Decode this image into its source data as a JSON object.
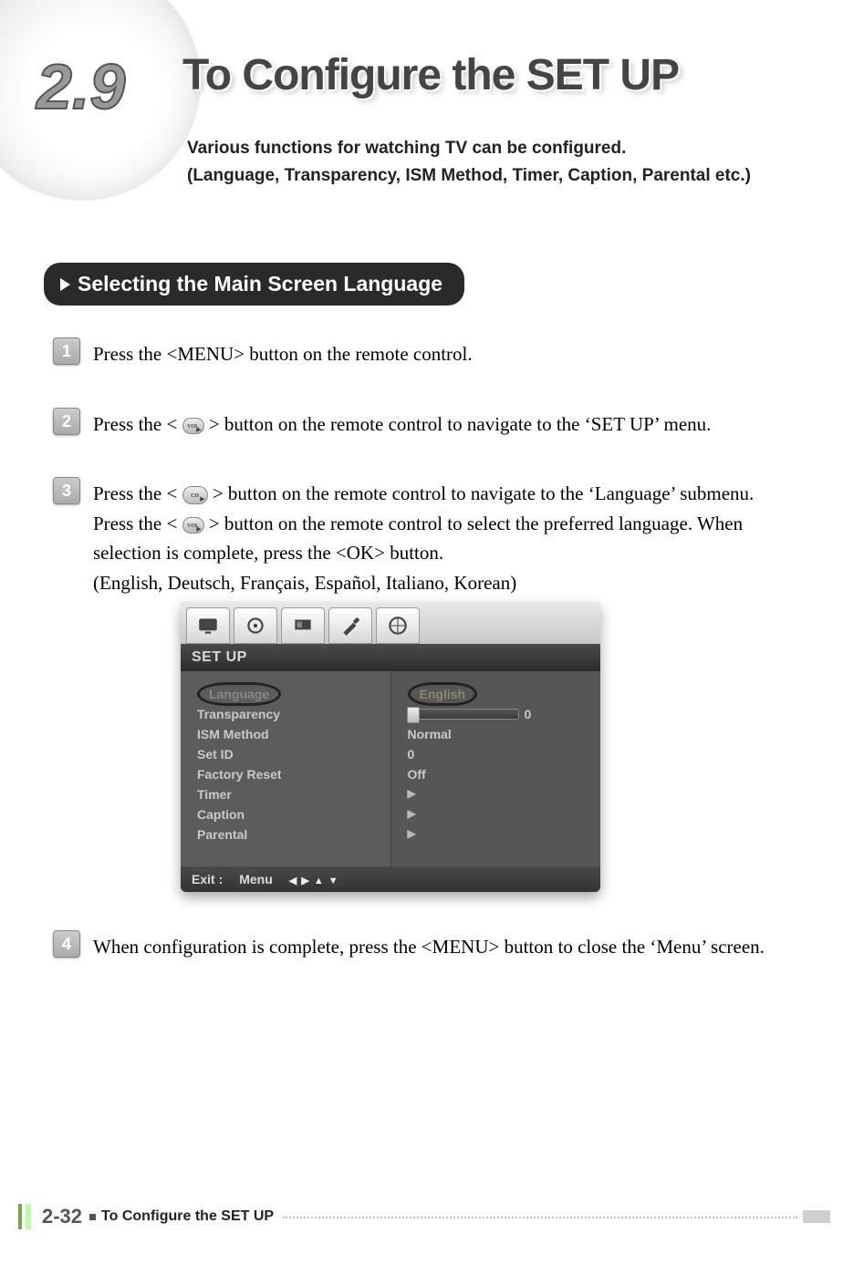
{
  "header": {
    "section_number": "2.9",
    "title": "To Configure the SET UP",
    "subtitle_line1": "Various functions for watching TV can be configured.",
    "subtitle_line2": "(Language, Transparency, ISM Method, Timer, Caption, Parental etc.)"
  },
  "h2": "Selecting the Main Screen Language",
  "steps": {
    "s1": {
      "n": "1",
      "text": "Press the <MENU> button on the remote control."
    },
    "s2": {
      "n": "2",
      "pre": "Press the < ",
      "btn_label": "VOL",
      "post": " > button on the remote control to navigate to the ‘SET UP’ menu."
    },
    "s3": {
      "n": "3",
      "pre": "Press the < ",
      "btn1_label": "CH",
      "mid1": " > button on the remote control to navigate to the ‘Language’ submenu. Press the < ",
      "btn2_label": "VOL",
      "mid2": " > button on the remote control to select the preferred language. When selection is complete, press the <OK> button.",
      "langs": "(English, Deutsch, Français, Español, Italiano, Korean)"
    },
    "s4": {
      "n": "4",
      "text": "When configuration is complete, press the <MENU> button to close the ‘Menu’ screen."
    }
  },
  "osd": {
    "title": "SET UP",
    "left_items": [
      "Language",
      "Transparency",
      "ISM Method",
      "Set ID",
      "Factory Reset",
      "Timer",
      "Caption",
      "Parental"
    ],
    "right_items": {
      "language_value": "English",
      "transparency_value": "0",
      "ism_value": "Normal",
      "setid_value": "0",
      "factory_value": "Off"
    },
    "footer_exit": "Exit :",
    "footer_menu": "Menu"
  },
  "footer": {
    "page_num": "2-32",
    "title": "To Configure the SET UP"
  }
}
